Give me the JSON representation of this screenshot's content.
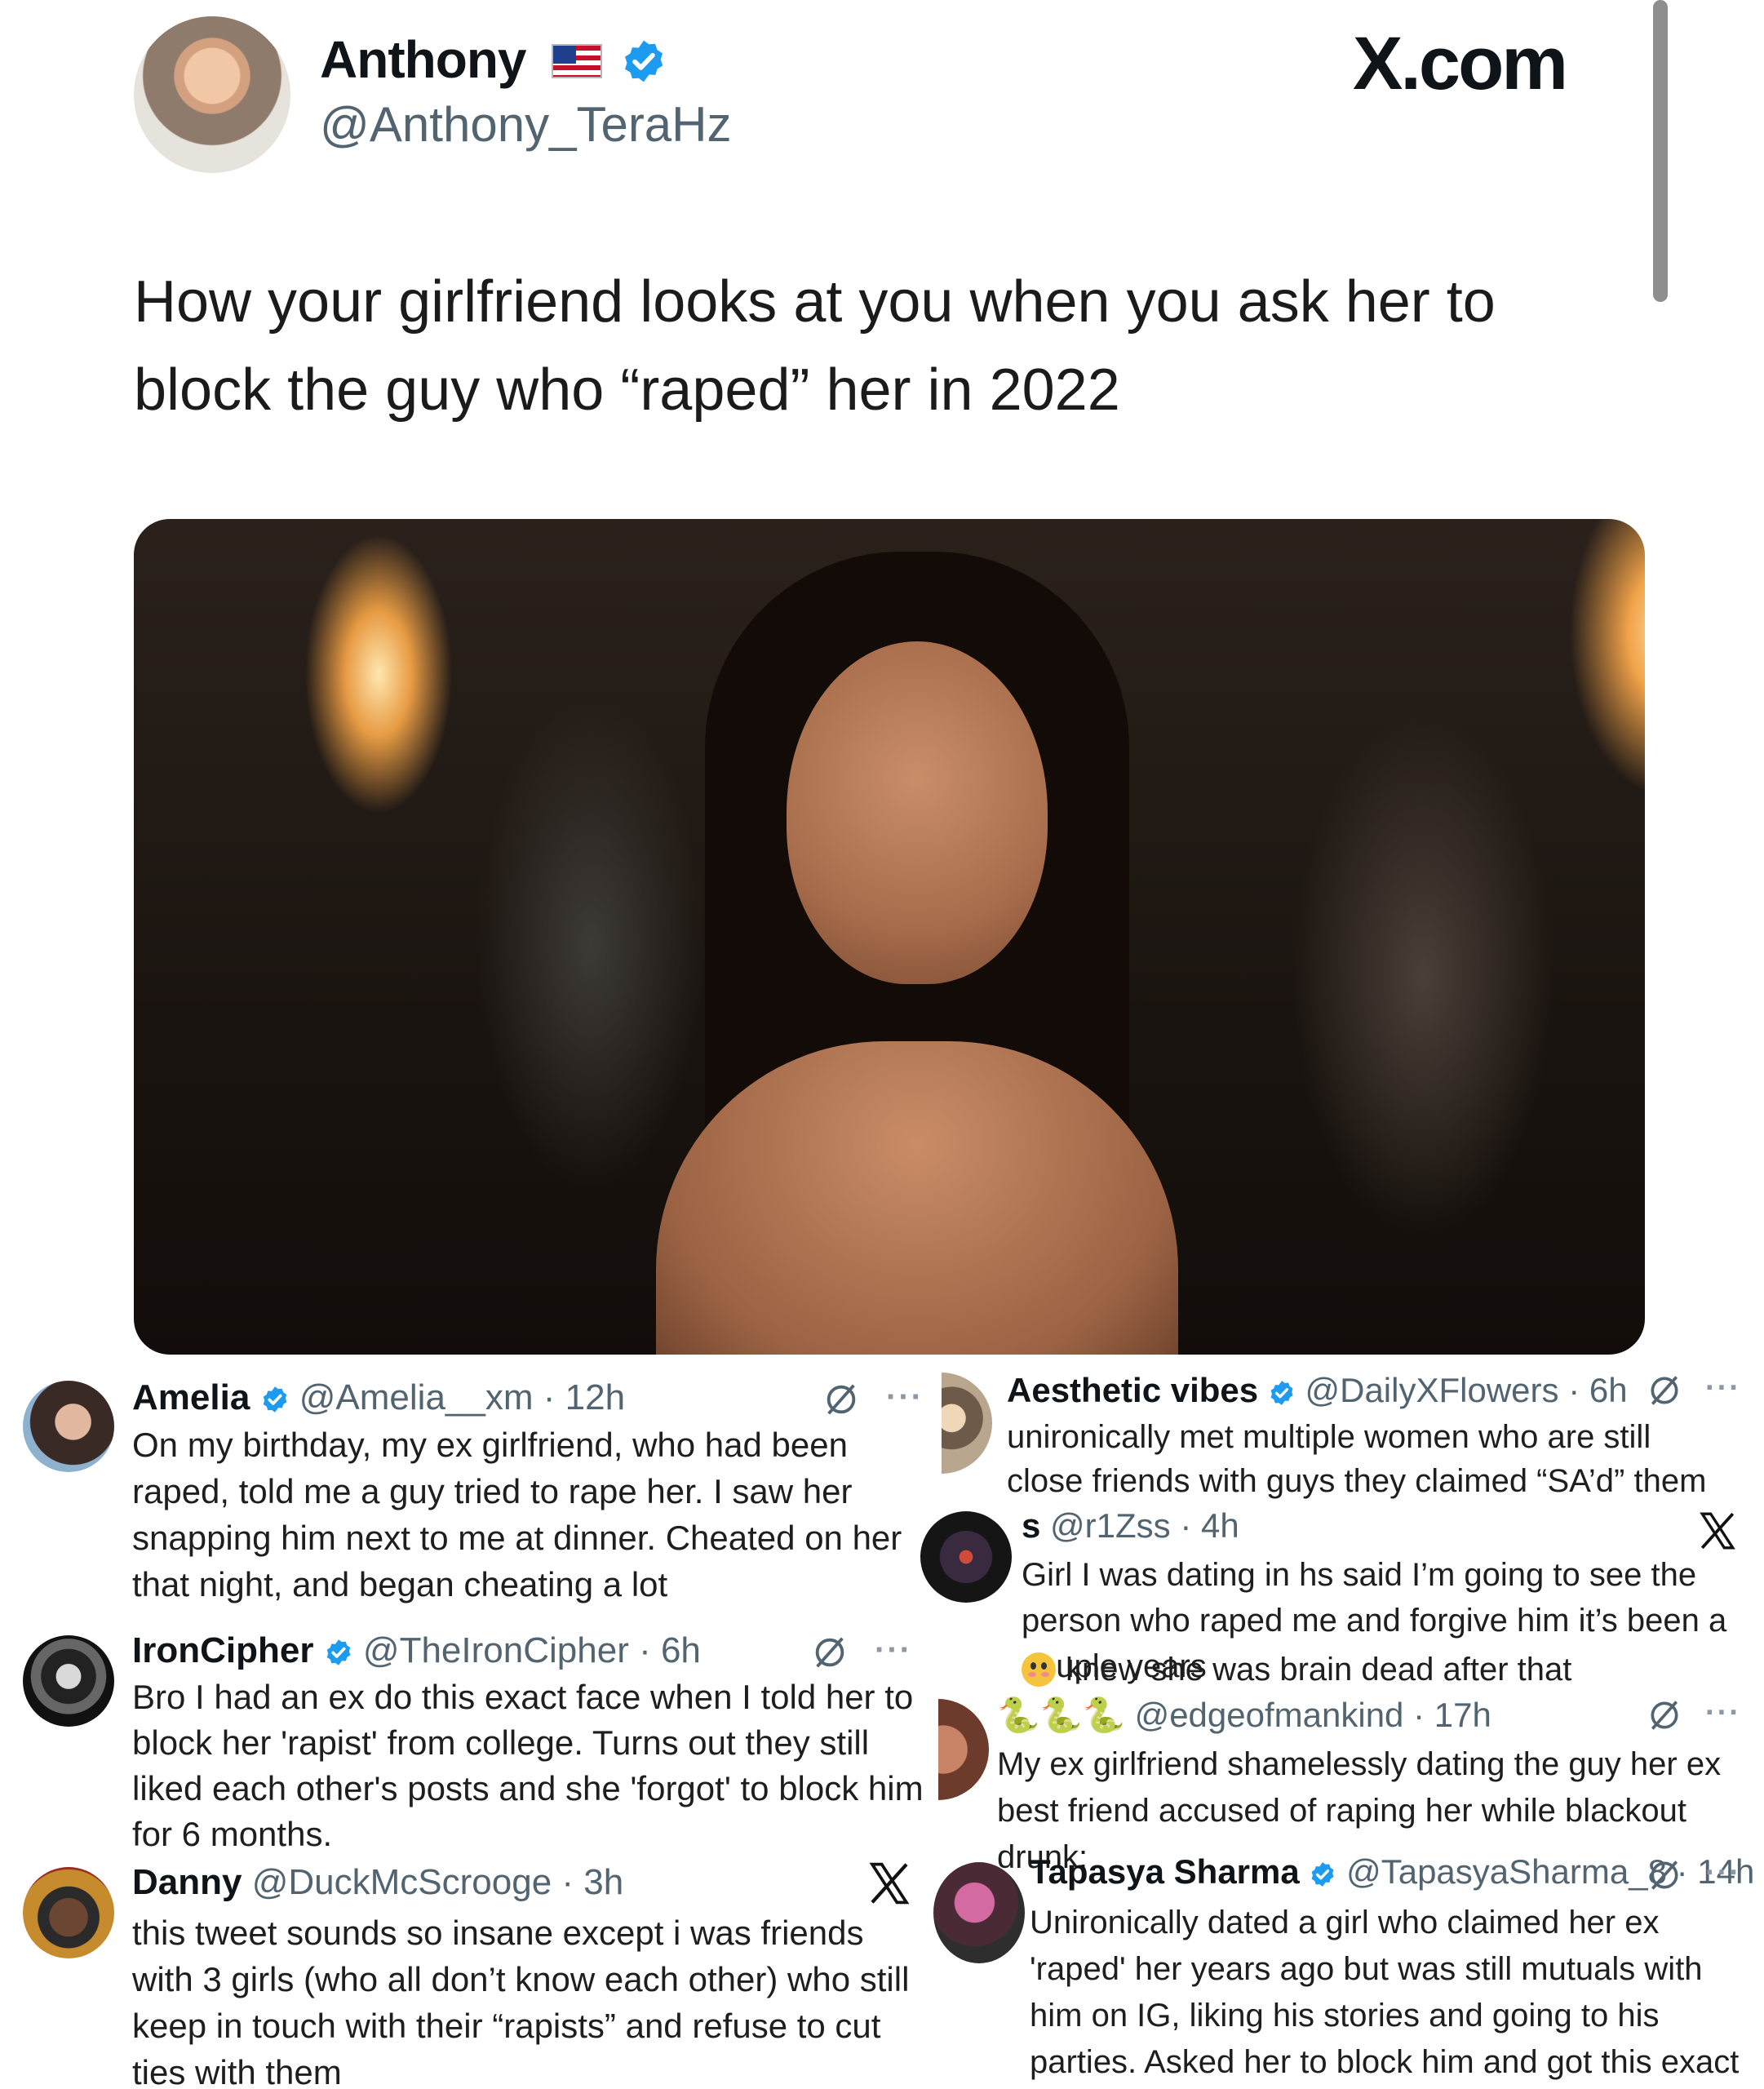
{
  "colors": {
    "verified": "#1d9bf0",
    "secondary_text": "#536471"
  },
  "main": {
    "author_name": "Anthony",
    "handle": "@Anthony_TeraHz",
    "site_label": "X.com",
    "text": "How your girlfriend looks at you when you ask her to block the guy who “raped” her in 2022"
  },
  "replies": [
    {
      "name": "Amelia",
      "handle": "@Amelia__xm",
      "time": "· 12h",
      "text": "On my birthday, my ex girlfriend, who had been raped, told me a guy tried to rape her. I saw her snapping him next to me at dinner. Cheated on her that night, and began cheating a lot"
    },
    {
      "name": "IronCipher",
      "handle": "@TheIronCipher",
      "time": "· 6h",
      "text": "Bro I had an ex do this exact face when I told her to block her 'rapist' from college. Turns out they still liked each other's posts and she 'forgot' to block him for 6 months."
    },
    {
      "name": "Danny",
      "handle": "@DuckMcScrooge",
      "time": "· 3h",
      "text": "this tweet sounds so insane except i was friends with 3 girls (who all don’t know each other) who still keep in touch with their “rapists” and refuse to cut ties with them"
    },
    {
      "name": "Aesthetic vibes",
      "handle": "@DailyXFlowers",
      "time": "· 6h",
      "text": "unironically met multiple women who are still close friends with guys they claimed “SA’d” them"
    },
    {
      "name": "s",
      "handle": "@r1Zss",
      "time": "· 4h",
      "text": "Girl I was dating in hs said I’m going to see the person who raped me and forgive him it’s been a couple years",
      "text_line3": "knew she was brain dead after that"
    },
    {
      "name": "🐍🐍🐍",
      "handle": "@edgeofmankind",
      "time": "· 17h",
      "text": "My ex girlfriend shamelessly dating the guy her ex best friend accused of raping her while blackout drunk:"
    },
    {
      "name": "Tapasya Sharma",
      "handle": "@TapasyaSharma_8",
      "time": "· 14h",
      "text": "Unironically dated a girl who claimed her ex 'raped' her years ago but was still mutuals with him on IG, liking his stories and going to his parties. Asked her to block him and got this exact face."
    }
  ]
}
